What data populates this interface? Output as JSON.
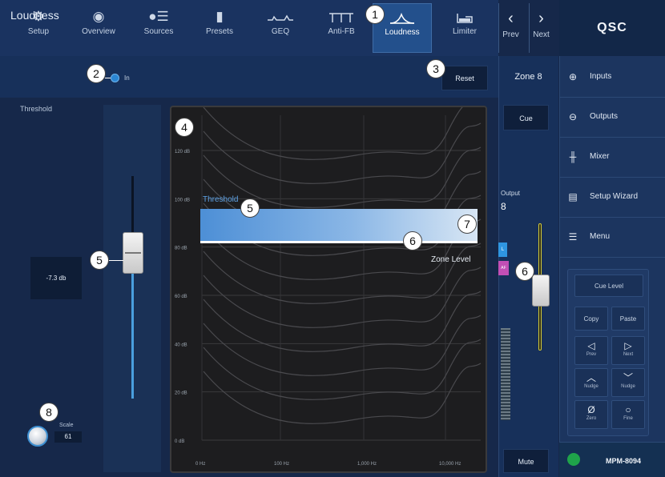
{
  "tabs": [
    {
      "label": "Setup",
      "icon": "gear-icon"
    },
    {
      "label": "Overview",
      "icon": "eye-icon"
    },
    {
      "label": "Sources",
      "icon": "sources-icon"
    },
    {
      "label": "Presets",
      "icon": "presets-icon"
    },
    {
      "label": "GEQ",
      "icon": "geq-icon"
    },
    {
      "label": "Anti-FB",
      "icon": "anti-fb-icon"
    },
    {
      "label": "Loudness",
      "icon": "loudness-icon",
      "active": true
    },
    {
      "label": "Limiter",
      "icon": "limiter-icon"
    }
  ],
  "nav": {
    "prev_label": "Prev",
    "next_label": "Next"
  },
  "brand": {
    "logo": "QSC"
  },
  "page": {
    "title": "Loudness",
    "in_label": "In",
    "reset_label": "Reset"
  },
  "threshold": {
    "label": "Threshold",
    "value": "-7.3 db",
    "level_fraction": 0.64
  },
  "scale": {
    "label": "Scale",
    "value": "61"
  },
  "graph": {
    "threshold_label": "Threshold",
    "zone_level_label": "Zone Level",
    "y_labels": [
      "120 dB",
      "100 dB",
      "80 dB",
      "60 dB",
      "40 dB",
      "20 dB",
      "0 dB"
    ],
    "x_labels": [
      "0 Hz",
      "100 Hz",
      "1,000 Hz",
      "10,000 Hz"
    ]
  },
  "zone": {
    "title": "Zone 8",
    "cue_label": "Cue",
    "output_label": "Output",
    "output_number": "8",
    "tag_l": "L",
    "tag_af": "AF",
    "mute_label": "Mute"
  },
  "sidebar": {
    "items": [
      {
        "label": "Inputs",
        "icon": "inputs-icon"
      },
      {
        "label": "Outputs",
        "icon": "outputs-icon"
      },
      {
        "label": "Mixer",
        "icon": "mixer-icon"
      },
      {
        "label": "Setup Wizard",
        "icon": "wizard-icon"
      },
      {
        "label": "Menu",
        "icon": "menu-icon"
      }
    ],
    "cue_level_label": "Cue Level",
    "copy_label": "Copy",
    "paste_label": "Paste",
    "prev_label": "Prev",
    "next_label": "Next",
    "nudge_label": "Nudge",
    "zero_label": "Zero",
    "fine_label": "Fine",
    "device": "MPM-8094"
  },
  "callouts": [
    "1",
    "2",
    "3",
    "4",
    "5",
    "5",
    "6",
    "6",
    "7",
    "8"
  ],
  "colors": {
    "accent": "#2b86d3",
    "active_tab": "#23508c",
    "output_fader": "#d7cc36",
    "af_tag": "#c24fb5"
  }
}
